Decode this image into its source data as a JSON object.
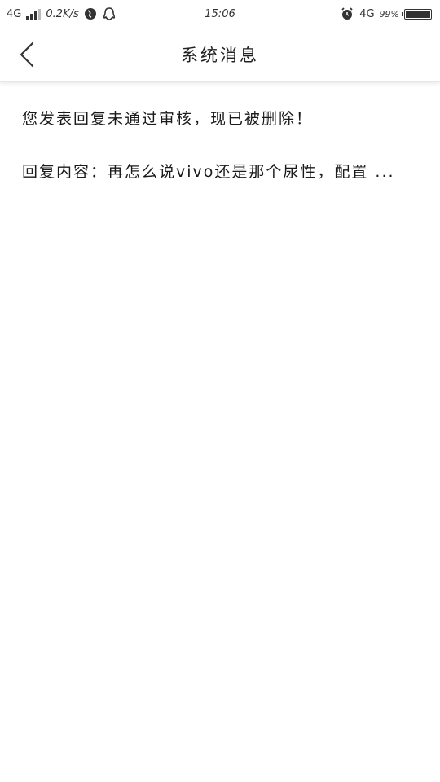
{
  "status_bar": {
    "network_left": "4G",
    "speed": "0.2K/s",
    "time": "15:06",
    "network_right": "4G",
    "battery": "99%",
    "battery_level": 0.99
  },
  "header": {
    "title": "系统消息"
  },
  "message": {
    "line1": "您发表回复未通过审核，现已被删除！",
    "line2": "回复内容：再怎么说vivo还是那个尿性，配置 ..."
  }
}
